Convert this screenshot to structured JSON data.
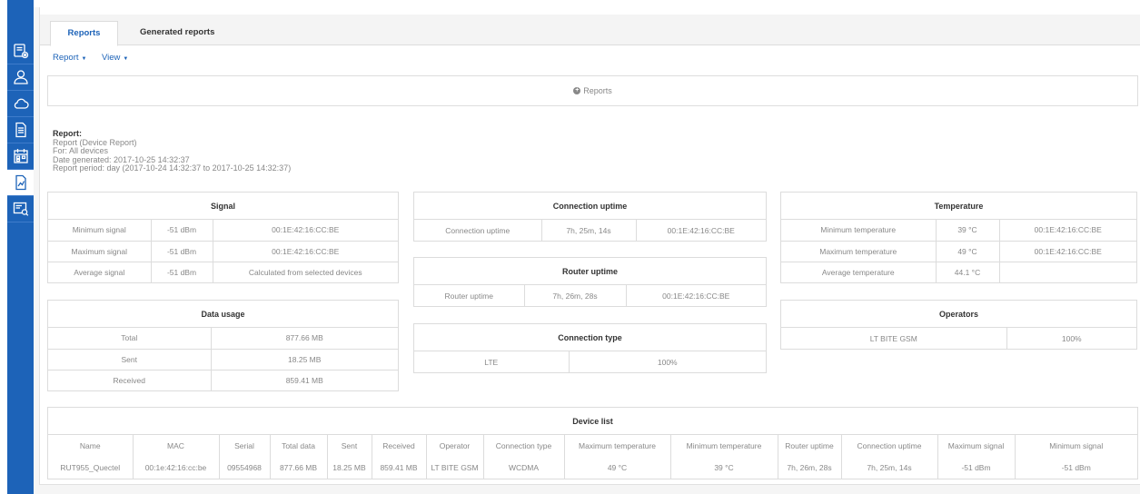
{
  "tabs": {
    "reports": "Reports",
    "generated": "Generated reports"
  },
  "toolbar": {
    "report": "Report",
    "view": "View"
  },
  "reports_box": {
    "label": "Reports"
  },
  "report_info": {
    "heading": "Report:",
    "name": "Report (Device Report)",
    "for": "For: All devices",
    "generated": "Date generated: 2017-10-25 14:32:37",
    "period": "Report period: day (2017-10-24 14:32:37 to 2017-10-25 14:32:37)"
  },
  "signal": {
    "title": "Signal",
    "rows": [
      [
        "Minimum signal",
        "-51 dBm",
        "00:1E:42:16:CC:BE"
      ],
      [
        "Maximum signal",
        "-51 dBm",
        "00:1E:42:16:CC:BE"
      ],
      [
        "Average signal",
        "-51 dBm",
        "Calculated from selected devices"
      ]
    ]
  },
  "data_usage": {
    "title": "Data usage",
    "rows": [
      [
        "Total",
        "877.66 MB"
      ],
      [
        "Sent",
        "18.25 MB"
      ],
      [
        "Received",
        "859.41 MB"
      ]
    ]
  },
  "connection_uptime": {
    "title": "Connection uptime",
    "rows": [
      [
        "Connection uptime",
        "7h, 25m, 14s",
        "00:1E:42:16:CC:BE"
      ]
    ]
  },
  "router_uptime": {
    "title": "Router uptime",
    "rows": [
      [
        "Router uptime",
        "7h, 26m, 28s",
        "00:1E:42:16:CC:BE"
      ]
    ]
  },
  "connection_type": {
    "title": "Connection type",
    "rows": [
      [
        "LTE",
        "100%"
      ]
    ]
  },
  "temperature": {
    "title": "Temperature",
    "rows": [
      [
        "Minimum temperature",
        "39 °C",
        "00:1E:42:16:CC:BE"
      ],
      [
        "Maximum temperature",
        "49 °C",
        "00:1E:42:16:CC:BE"
      ],
      [
        "Average temperature",
        "44.1 °C",
        ""
      ]
    ]
  },
  "operators": {
    "title": "Operators",
    "rows": [
      [
        "LT BITE GSM",
        "100%"
      ]
    ]
  },
  "device_list": {
    "title": "Device list",
    "headers": [
      "Name",
      "MAC",
      "Serial",
      "Total data",
      "Sent",
      "Received",
      "Operator",
      "Connection type",
      "Maximum temperature",
      "Minimum temperature",
      "Router uptime",
      "Connection uptime",
      "Maximum signal",
      "Minimum signal"
    ],
    "rows": [
      [
        "RUT955_Quectel",
        "00:1e:42:16:cc:be",
        "09554968",
        "877.66 MB",
        "18.25 MB",
        "859.41 MB",
        "LT BITE GSM",
        "WCDMA",
        "49 °C",
        "39 °C",
        "7h, 26m, 28s",
        "7h, 25m, 14s",
        "-51 dBm",
        "-51 dBm"
      ]
    ]
  },
  "colors": {
    "accent": "#1d63b8",
    "border": "#dcdcdc"
  }
}
